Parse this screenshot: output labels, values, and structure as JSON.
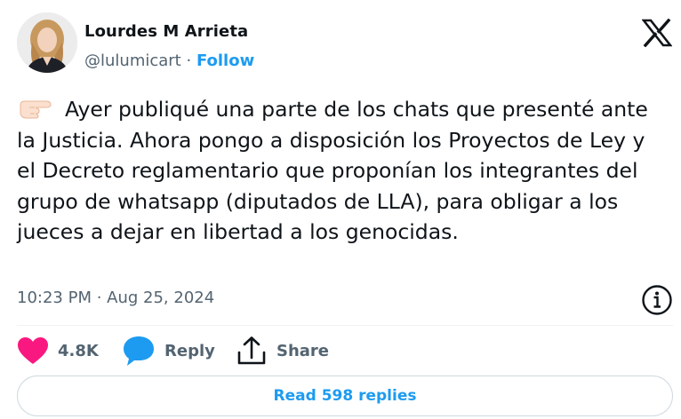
{
  "author": {
    "name": "Lourdes M Arrieta",
    "handle": "@lulumicart",
    "separator": "·",
    "follow_label": "Follow"
  },
  "tweet": {
    "pointing_icon": "backhand-index-pointing-right-emoji",
    "text": "Ayer publiqué una parte de los chats que presenté ante la Justicia. Ahora pongo a disposición los Proyectos de Ley y el Decreto reglamentario que proponían los integrantes del grupo de whatsapp (diputados de LLA), para obligar a los jueces a dejar en libertad a los genocidas.",
    "timestamp": "10:23 PM · Aug 25, 2024"
  },
  "actions": {
    "likes_count": "4.8K",
    "reply_label": "Reply",
    "share_label": "Share"
  },
  "read_replies_label": "Read 598 replies",
  "colors": {
    "accent": "#1d9bf0",
    "like": "#f91880",
    "text": "#0f1419",
    "muted": "#536471"
  },
  "icons": [
    "x-logo-icon",
    "info-icon",
    "heart-icon",
    "reply-bubble-icon",
    "share-icon"
  ]
}
